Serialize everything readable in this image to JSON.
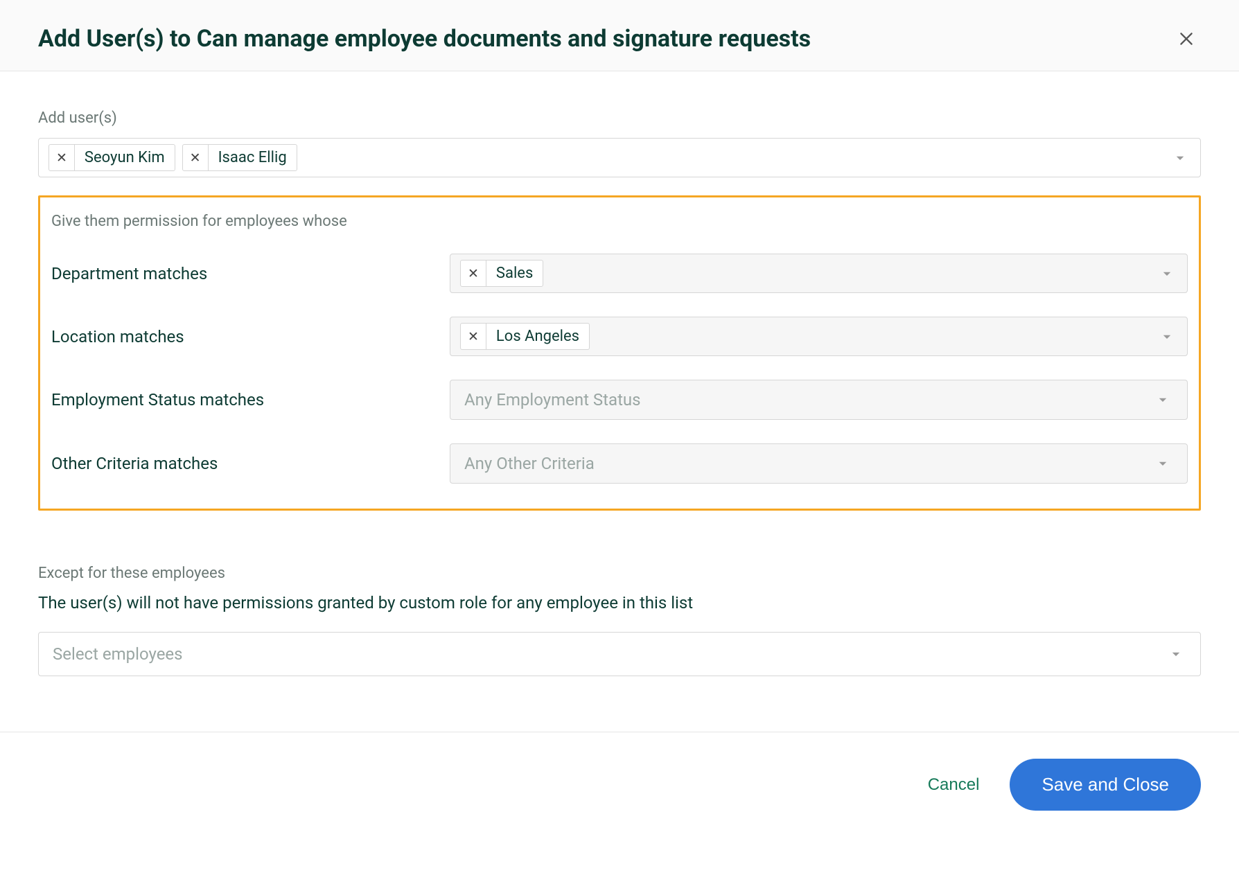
{
  "header": {
    "title": "Add User(s) to Can manage employee documents and signature requests"
  },
  "addUsers": {
    "label": "Add user(s)",
    "chips": [
      "Seoyun Kim",
      "Isaac Ellig"
    ]
  },
  "criteria": {
    "intro": "Give them permission for employees whose",
    "rows": {
      "department": {
        "label": "Department matches",
        "chips": [
          "Sales"
        ]
      },
      "location": {
        "label": "Location matches",
        "chips": [
          "Los Angeles"
        ]
      },
      "employmentStatus": {
        "label": "Employment Status matches",
        "placeholder": "Any Employment Status"
      },
      "otherCriteria": {
        "label": "Other Criteria matches",
        "placeholder": "Any Other Criteria"
      }
    }
  },
  "except": {
    "label": "Except for these employees",
    "description": "The user(s) will not have permissions granted by custom role for any employee in this list",
    "placeholder": "Select employees"
  },
  "footer": {
    "cancel": "Cancel",
    "save": "Save and Close"
  }
}
